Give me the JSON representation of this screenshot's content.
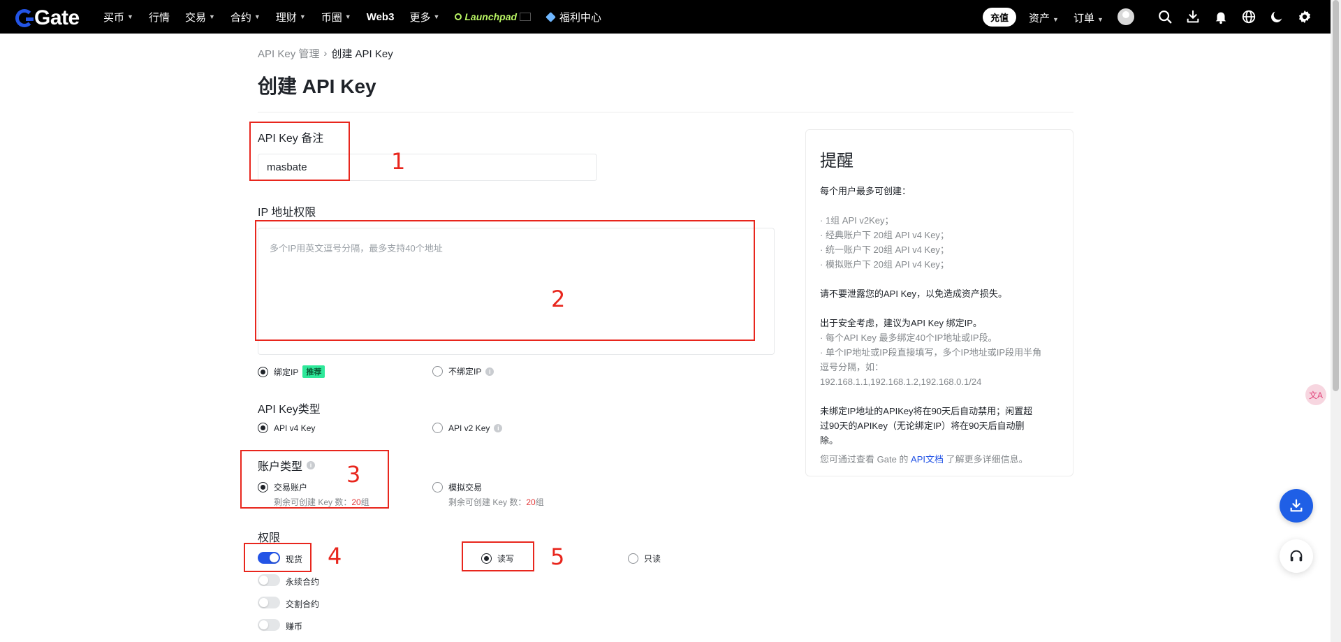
{
  "nav": {
    "logo_text": "Gate",
    "items": [
      {
        "label": "买币",
        "caret": true
      },
      {
        "label": "行情",
        "caret": false
      },
      {
        "label": "交易",
        "caret": true
      },
      {
        "label": "合约",
        "caret": true
      },
      {
        "label": "理财",
        "caret": true
      },
      {
        "label": "币圈",
        "caret": true
      },
      {
        "label": "Web3",
        "caret": false
      },
      {
        "label": "更多",
        "caret": true
      }
    ],
    "launchpad": "Launchpad",
    "welfare": "福利中心",
    "deposit": "充值",
    "assets": "资产",
    "orders": "订单"
  },
  "breadcrumb": {
    "parent": "API Key 管理",
    "separator": "›",
    "current": "创建 API Key"
  },
  "page_title": "创建 API Key",
  "form": {
    "note_label": "API Key 备注",
    "note_value": "masbate",
    "ip_label": "IP 地址权限",
    "ip_placeholder": "多个IP用英文逗号分隔，最多支持40个地址",
    "bind_ip": "绑定IP",
    "bind_ip_tag": "推荐",
    "no_bind_ip": "不绑定IP",
    "key_type_label": "API Key类型",
    "v4": "API v4 Key",
    "v2": "API v2 Key",
    "account_type_label": "账户类型",
    "trade_account": "交易账户",
    "trade_remaining_prefix": "剩余可创建 Key 数：",
    "trade_remaining_count": "20",
    "trade_remaining_unit": "组",
    "demo_account": "模拟交易",
    "demo_remaining_prefix": "剩余可创建 Key 数：",
    "demo_remaining_count": "20",
    "demo_remaining_unit": "组",
    "perm_label": "权限",
    "perms": [
      {
        "label": "现货",
        "on": true
      },
      {
        "label": "永续合约",
        "on": false
      },
      {
        "label": "交割合约",
        "on": false
      },
      {
        "label": "赚币",
        "on": false
      }
    ],
    "read_write": "读写",
    "read_only": "只读"
  },
  "annotations": [
    "1",
    "2",
    "3",
    "4",
    "5"
  ],
  "reminder": {
    "title": "提醒",
    "intro": "每个用户最多可创建：",
    "limits": [
      "· 1组 API v2Key；",
      "· 经典账户下 20组 API v4 Key；",
      "· 统一账户下 20组 API v4 Key；",
      "· 模拟账户下 20组 API v4 Key；"
    ],
    "warn": "请不要泄露您的API Key，以免造成资产损失。",
    "security": "出于安全考虑，建议为API Key 绑定IP。",
    "ip_rules": [
      "· 每个API Key 最多绑定40个IP地址或IP段。",
      "· 单个IP地址或IP段直接填写，多个IP地址或IP段用半角",
      "逗号分隔，如：",
      "192.168.1.1,192.168.1.2,192.168.0.1/24"
    ],
    "auto_disable": [
      "未绑定IP地址的APIKey将在90天后自动禁用；闲置超",
      "过90天的APIKey（无论绑定IP）将在90天后自动删",
      "除。"
    ],
    "doc_prefix": "您可通过查看 Gate 的 ",
    "doc_link": "API文档",
    "doc_suffix": " 了解更多详细信息。"
  },
  "translate_badge": "文A",
  "colors": {
    "accent": "#2354e6",
    "annotation": "#e8261d",
    "tag": "#2ee89a"
  }
}
